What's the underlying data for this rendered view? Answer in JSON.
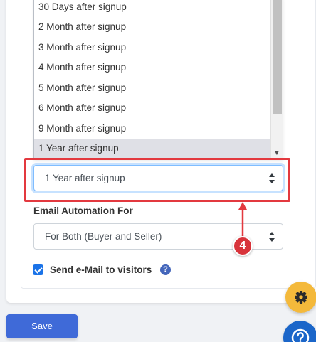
{
  "signup_delay": {
    "options": [
      "30 Days after signup",
      "2 Month after signup",
      "3 Month after signup",
      "4 Month after signup",
      "5 Month after signup",
      "6 Month after signup",
      "9 Month after signup",
      "1 Year after signup"
    ],
    "selected_value": "1 Year after signup"
  },
  "email_automation": {
    "label": "Email Automation For",
    "selected_value": "For Both (Buyer and Seller)"
  },
  "send_email": {
    "label": "Send e-Mail to visitors",
    "checked": true,
    "help_glyph": "?"
  },
  "annotation": {
    "step_number": "4",
    "color": "#e3393f"
  },
  "actions": {
    "save_label": "Save"
  },
  "floating": {
    "settings_icon": "gear-icon",
    "help_icon": "question-icon"
  }
}
